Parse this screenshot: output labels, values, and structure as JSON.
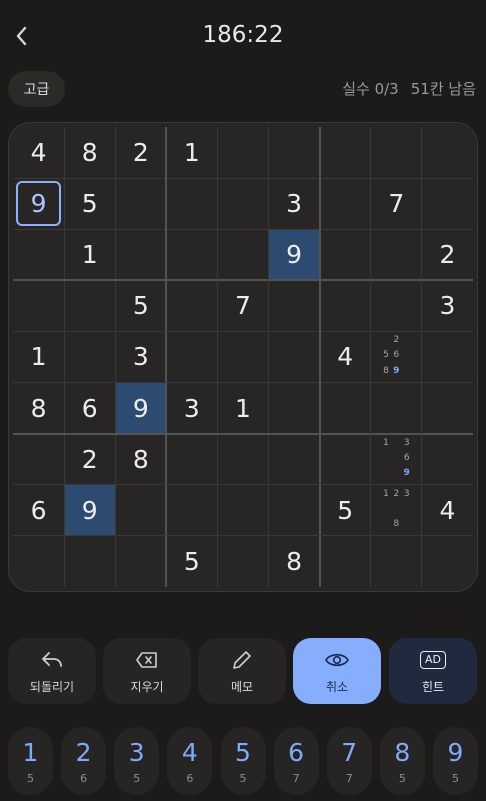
{
  "header": {
    "back_icon": "chevron-left-icon",
    "timer": "186:22"
  },
  "info": {
    "level": "고급",
    "mistakes": "실수 0/3",
    "remaining": "51칸 남음"
  },
  "board": {
    "cells": [
      [
        "4",
        "8",
        "2",
        "1",
        "",
        "",
        "",
        "",
        ""
      ],
      [
        "9",
        "5",
        "",
        "",
        "",
        "3",
        "",
        "7",
        ""
      ],
      [
        "",
        "1",
        "",
        "",
        "",
        "9",
        "",
        "",
        "2"
      ],
      [
        "",
        "",
        "5",
        "",
        "7",
        "",
        "",
        "",
        "3"
      ],
      [
        "1",
        "",
        "3",
        "",
        "",
        "",
        "4",
        "",
        ""
      ],
      [
        "8",
        "6",
        "9",
        "3",
        "1",
        "",
        "",
        "",
        ""
      ],
      [
        "",
        "2",
        "8",
        "",
        "",
        "",
        "",
        "",
        ""
      ],
      [
        "6",
        "9",
        "",
        "",
        "",
        "",
        "5",
        "",
        "4"
      ],
      [
        "",
        "",
        "",
        "5",
        "",
        "8",
        "",
        "",
        ""
      ]
    ],
    "selected": [
      1,
      0
    ],
    "highlighted": [
      [
        2,
        5
      ],
      [
        5,
        2
      ],
      [
        7,
        1
      ]
    ],
    "notes": [
      {
        "row": 4,
        "col": 7,
        "values": [
          "",
          "2",
          "",
          "5",
          "6",
          "",
          "8",
          "9",
          ""
        ],
        "highlight": "9"
      },
      {
        "row": 6,
        "col": 7,
        "values": [
          "1",
          "",
          "3",
          "",
          "",
          "6",
          "",
          "",
          "9"
        ],
        "highlight": "9"
      },
      {
        "row": 7,
        "col": 7,
        "values": [
          "1",
          "2",
          "3",
          "",
          "",
          "",
          "",
          "8",
          ""
        ],
        "highlight": ""
      }
    ],
    "colors": {
      "highlight": "#2d4a70",
      "selected_border": "#8ab0ff",
      "accent": "#86aefd"
    }
  },
  "actions": [
    {
      "label": "되돌리기",
      "icon": "undo-icon"
    },
    {
      "label": "지우기",
      "icon": "erase-icon"
    },
    {
      "label": "메모",
      "icon": "pencil-icon"
    },
    {
      "label": "취소",
      "icon": "eye-icon"
    },
    {
      "label": "힌트",
      "icon": "ad-icon",
      "badge": "AD"
    }
  ],
  "numpad": [
    {
      "digit": "1",
      "count": "5"
    },
    {
      "digit": "2",
      "count": "6"
    },
    {
      "digit": "3",
      "count": "5"
    },
    {
      "digit": "4",
      "count": "6"
    },
    {
      "digit": "5",
      "count": "5"
    },
    {
      "digit": "6",
      "count": "7"
    },
    {
      "digit": "7",
      "count": "7"
    },
    {
      "digit": "8",
      "count": "5"
    },
    {
      "digit": "9",
      "count": "5"
    }
  ]
}
